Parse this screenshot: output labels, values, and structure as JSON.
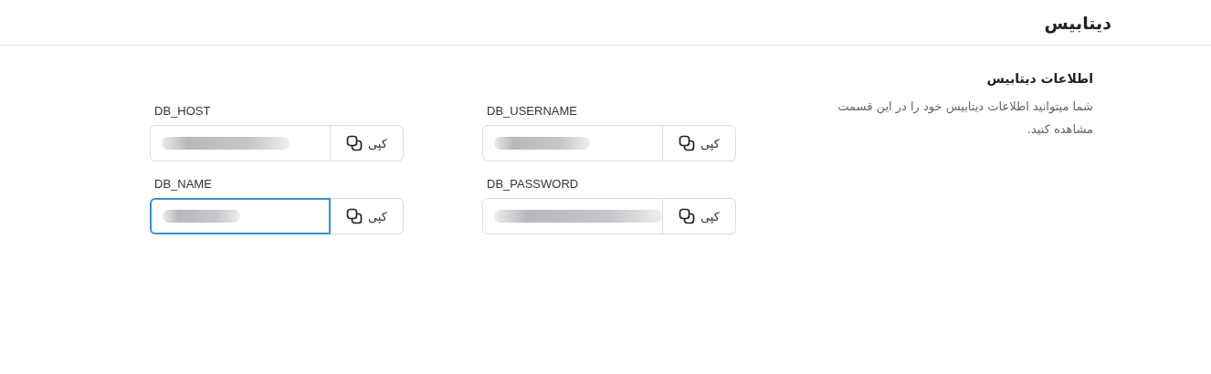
{
  "title": "دیتابیس",
  "section": {
    "heading": "اطلاعات دیتابیس",
    "description": "شما میتوانید اطلاعات دیتابیس خود را در این قسمت مشاهده کنید."
  },
  "fields": [
    {
      "label": "DB_USERNAME",
      "focused": false,
      "button": "کپی"
    },
    {
      "label": "DB_HOST",
      "focused": false,
      "button": "کپی"
    },
    {
      "label": "DB_PASSWORD",
      "focused": false,
      "button": "کپی"
    },
    {
      "label": "DB_NAME",
      "focused": true,
      "button": "کپی"
    }
  ]
}
